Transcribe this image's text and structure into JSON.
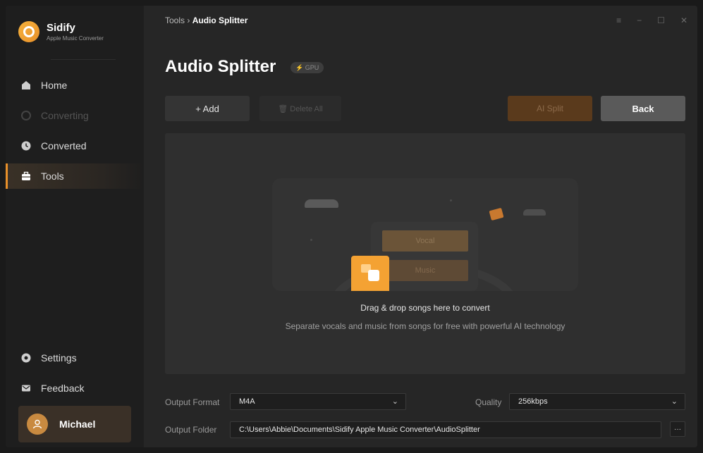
{
  "app": {
    "name": "Sidify",
    "subtitle": "Apple Music Converter"
  },
  "sidebar": {
    "items": [
      {
        "label": "Home",
        "icon": "home-icon"
      },
      {
        "label": "Converting",
        "icon": "converting-icon",
        "disabled": true
      },
      {
        "label": "Converted",
        "icon": "clock-icon"
      },
      {
        "label": "Tools",
        "icon": "toolbox-icon",
        "active": true
      }
    ],
    "bottom_items": [
      {
        "label": "Settings",
        "icon": "gear-icon"
      },
      {
        "label": "Feedback",
        "icon": "mail-icon"
      }
    ],
    "user": {
      "name": "Michael"
    }
  },
  "header": {
    "breadcrumb_parent": "Tools",
    "breadcrumb_sep": "›",
    "breadcrumb_current": "Audio Splitter",
    "window_controls": [
      "≡",
      "−",
      "☐",
      "✕"
    ]
  },
  "page": {
    "title": "Audio Splitter",
    "badge": "⚡ GPU"
  },
  "toolbar": {
    "add_label": "+ Add",
    "delete_label": "🗑 Delete All",
    "ai_split_label": "AI Split",
    "back_label": "Back"
  },
  "dropzone": {
    "vocal_label": "Vocal",
    "music_label": "Music",
    "main_text": "Drag & drop songs here to convert",
    "sub_text": "Separate vocals and music from songs for free with powerful AI technology"
  },
  "settings": {
    "output_format_label": "Output Format",
    "output_format_value": "M4A",
    "quality_label": "Quality",
    "quality_value": "256kbps",
    "output_folder_label": "Output Folder",
    "output_folder_value": "C:\\Users\\Abbie\\Documents\\Sidify Apple Music Converter\\AudioSplitter",
    "more_label": "···"
  },
  "colors": {
    "accent": "#e8902a",
    "background": "#262626",
    "sidebar": "#1e1e1e"
  }
}
